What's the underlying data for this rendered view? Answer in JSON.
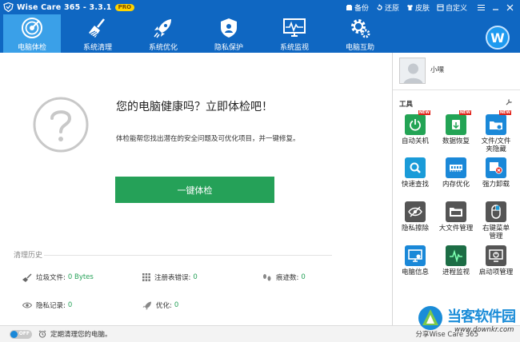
{
  "app": {
    "title": "Wise Care 365 - 3.3.1",
    "badge": "PRO"
  },
  "titlebar": {
    "actions": [
      {
        "label": "备份",
        "icon": "backup-icon"
      },
      {
        "label": "还原",
        "icon": "restore-icon"
      },
      {
        "label": "皮肤",
        "icon": "skin-icon"
      },
      {
        "label": "自定义",
        "icon": "customize-icon"
      }
    ]
  },
  "nav": {
    "tabs": [
      {
        "label": "电脑体检",
        "icon": "radar-icon",
        "active": true
      },
      {
        "label": "系统清理",
        "icon": "broom-icon",
        "active": false
      },
      {
        "label": "系统优化",
        "icon": "rocket-icon",
        "active": false
      },
      {
        "label": "隐私保护",
        "icon": "privacy-shield-icon",
        "active": false
      },
      {
        "label": "系统监视",
        "icon": "monitor-icon",
        "active": false
      },
      {
        "label": "电脑互助",
        "icon": "gear-icon",
        "active": false
      }
    ],
    "avatar_letter": "W"
  },
  "main": {
    "heading": "您的电脑健康吗？立即体检吧！",
    "description": "体检能帮您找出潜在的安全问题及可优化项目，并一键修复。",
    "check_button": "一键体检",
    "history_title": "清理历史",
    "stats": {
      "junk": {
        "label": "垃圾文件:",
        "value": "0 Bytes"
      },
      "registry": {
        "label": "注册表错误:",
        "value": "0"
      },
      "traces": {
        "label": "痕迹数:",
        "value": "0"
      },
      "privacy": {
        "label": "隐私记录:",
        "value": "0"
      },
      "optimize": {
        "label": "优化:",
        "value": "0"
      }
    }
  },
  "side": {
    "user_name": "小嘿",
    "tools_title": "工具",
    "new_badge": "NEW",
    "tools": [
      {
        "label": "自动关机",
        "icon": "power-icon",
        "color": "#23a455",
        "is_new": true
      },
      {
        "label": "数据恢复",
        "icon": "data-recovery-icon",
        "color": "#23a455",
        "is_new": true
      },
      {
        "label": "文件/文件夹隐藏",
        "icon": "folder-hide-icon",
        "color": "#1a88d8",
        "is_new": true
      },
      {
        "label": "快速查找",
        "icon": "magnifier-icon",
        "color": "#1a9bd8",
        "is_new": false
      },
      {
        "label": "内存优化",
        "icon": "memory-icon",
        "color": "#1a88d8",
        "is_new": false
      },
      {
        "label": "强力卸载",
        "icon": "uninstall-icon",
        "color": "#1a88d8",
        "is_new": false
      },
      {
        "label": "隐私擦除",
        "icon": "eye-erase-icon",
        "color": "#555555",
        "is_new": false
      },
      {
        "label": "大文件管理",
        "icon": "big-file-icon",
        "color": "#555555",
        "is_new": false
      },
      {
        "label": "右键菜单管理",
        "icon": "mouse-icon",
        "color": "#555555",
        "is_new": false
      },
      {
        "label": "电脑信息",
        "icon": "pc-info-icon",
        "color": "#1a88d8",
        "is_new": false
      },
      {
        "label": "进程监视",
        "icon": "process-monitor-icon",
        "color": "#1c6d45",
        "is_new": false
      },
      {
        "label": "启动项管理",
        "icon": "startup-icon",
        "color": "#555555",
        "is_new": false
      }
    ]
  },
  "status": {
    "toggle": "OFF",
    "text": "定期清理您的电脑。",
    "share": "分享Wise Care 365"
  },
  "watermark": {
    "text": "当客软件园",
    "url": "www.downkr.com"
  },
  "colors": {
    "brand_blue": "#0f67c2",
    "active_tab": "#3aa0e8",
    "button_green": "#25a158"
  }
}
